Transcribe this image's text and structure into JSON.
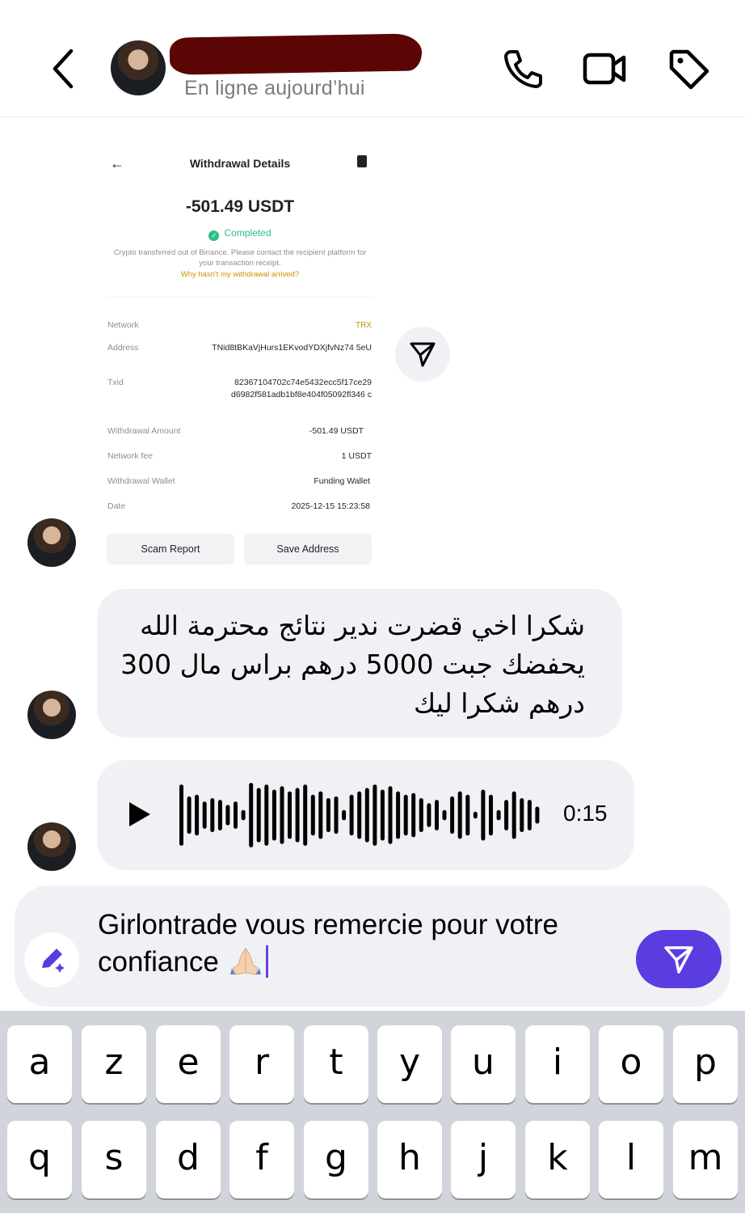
{
  "header": {
    "status": "En ligne aujourd’hui"
  },
  "shared_screenshot": {
    "title": "Withdrawal Details",
    "amount": "-501.49 USDT",
    "status": "Completed",
    "note": "Crypto transferred out of Binance. Please contact the recipient platform for your transaction receipt.",
    "link": "Why hasn't my withdrawal arrived?",
    "rows": [
      {
        "label": "Network",
        "value": "TRX"
      },
      {
        "label": "Address",
        "value": "TNid8tBKaVjHurs1EKvodYDXjfvNz74 5eU"
      },
      {
        "label": "Txid",
        "value": "82367104702c74e5432ecc5f17ce29 d6982f581adb1bf8e404f05092fl346 c"
      },
      {
        "label": "Withdrawal Amount",
        "value": "-501.49 USDT"
      },
      {
        "label": "Network fee",
        "value": "1 USDT"
      },
      {
        "label": "Withdrawal Wallet",
        "value": "Funding Wallet"
      },
      {
        "label": "Date",
        "value": "2025-12-15 15:23:58"
      }
    ],
    "buttons": {
      "scam_report": "Scam Report",
      "save_address": "Save Address"
    }
  },
  "messages": {
    "arabic_text": "شكرا اخي قضرت ندير نتائج محترمة الله يحفضك جبت 5000 درهم براس مال 300 درهم شكرا ليك",
    "voice_duration": "0:15",
    "voice_levels": [
      0.9,
      0.55,
      0.6,
      0.4,
      0.5,
      0.45,
      0.3,
      0.4,
      0.15,
      0.95,
      0.8,
      0.9,
      0.75,
      0.85,
      0.7,
      0.8,
      0.9,
      0.6,
      0.7,
      0.5,
      0.55,
      0.15,
      0.6,
      0.7,
      0.8,
      0.9,
      0.75,
      0.85,
      0.7,
      0.6,
      0.65,
      0.5,
      0.35,
      0.45,
      0.15,
      0.55,
      0.7,
      0.6,
      0.1,
      0.75,
      0.6,
      0.15,
      0.45,
      0.7,
      0.5,
      0.45,
      0.25
    ]
  },
  "composer": {
    "text": "Girlontrade vous remercie pour votre confiance"
  },
  "keyboard": {
    "row1": [
      "a",
      "z",
      "e",
      "r",
      "t",
      "y",
      "u",
      "i",
      "o",
      "p"
    ],
    "row2": [
      "q",
      "s",
      "d",
      "f",
      "g",
      "h",
      "j",
      "k",
      "l",
      "m"
    ]
  },
  "colors": {
    "accent": "#5a3ce0",
    "bubble": "#f0f1f4",
    "completed": "#2ebd85",
    "link": "#c99400",
    "keyboard_bg": "#d1d4db"
  }
}
